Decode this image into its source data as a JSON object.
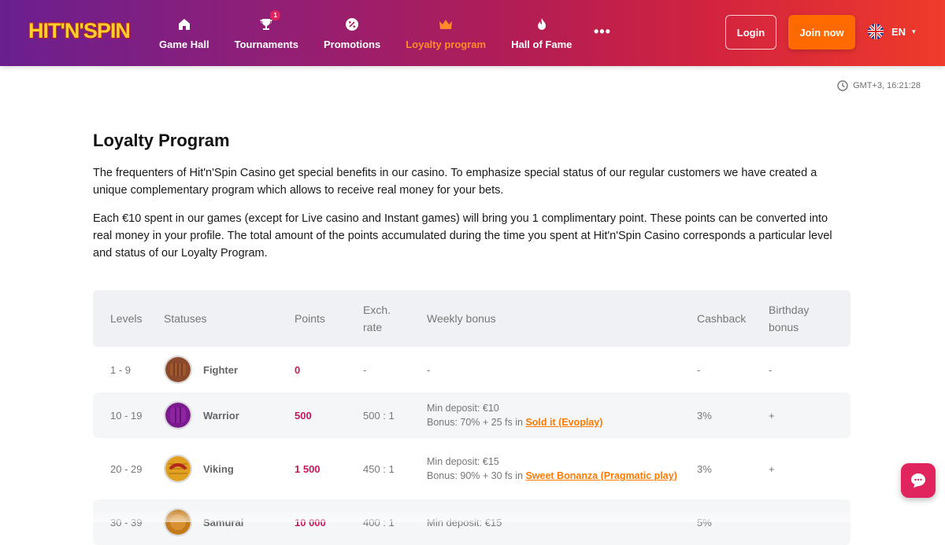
{
  "brand": {
    "logo_text": "HIT'N'SPIN"
  },
  "nav": [
    {
      "label": "Game Hall",
      "icon": "home-icon"
    },
    {
      "label": "Tournaments",
      "icon": "trophy-icon",
      "badge": "1"
    },
    {
      "label": "Promotions",
      "icon": "percent-badge-icon"
    },
    {
      "label": "Loyalty program",
      "icon": "crown-icon",
      "active": true
    },
    {
      "label": "Hall of Fame",
      "icon": "flame-icon"
    }
  ],
  "header": {
    "more": "•••",
    "login": "Login",
    "join": "Join now",
    "lang": "EN"
  },
  "clock": "GMT+3, 16:21:28",
  "page": {
    "title": "Loyalty Program",
    "p1": "The frequenters of Hit'n'Spin Casino get special benefits in our casino. To emphasize special status of our regular customers we have created a unique complementary program which allows to receive real money for your bets.",
    "p2": "Each €10 spent in our games (except for Live casino and Instant games) will bring you 1 complimentary point. These points can be converted into real money in your profile. The total amount of the points accumulated during the time you spent at Hit'n'Spin Casino corresponds a particular level and status of our Loyalty Program."
  },
  "table": {
    "headers": {
      "levels": "Levels",
      "statuses": "Statuses",
      "points": "Points",
      "exch1": "Exch.",
      "exch2": "rate",
      "weekly": "Weekly bonus",
      "cashback": "Cashback",
      "bday1": "Birthday",
      "bday2": "bonus"
    },
    "rows": [
      {
        "levels": "1 - 9",
        "status": "Fighter",
        "points": "0",
        "exch": "-",
        "weekly_line1": "-",
        "weekly_line2": "",
        "weekly_link": "",
        "cashback": "-",
        "birthday": "-",
        "color": "#8b4a2b"
      },
      {
        "levels": "10 - 19",
        "status": "Warrior",
        "points": "500",
        "exch": "500 : 1",
        "weekly_line1": "Min deposit: €10",
        "weekly_line2": "Bonus: 70% + 25 fs in ",
        "weekly_link": "Sold it (Evoplay)",
        "cashback": "3%",
        "birthday": "+",
        "color": "#7a1a8c"
      },
      {
        "levels": "20 - 29",
        "status": "Viking",
        "points": "1 500",
        "exch": "450 : 1",
        "weekly_line1": "Min deposit: €15",
        "weekly_line2": "Bonus: 90% + 30 fs in ",
        "weekly_link": "Sweet Bonanza (Pragmatic play)",
        "cashback": "3%",
        "birthday": "+",
        "color": "#e0a020"
      },
      {
        "levels": "30 - 39",
        "status": "Samurai",
        "points": "10 000",
        "exch": "400 : 1",
        "weekly_line1": "Min deposit: €15",
        "weekly_line2": "",
        "weekly_link": "",
        "cashback": "5%",
        "birthday": "",
        "color": "#c27a1a"
      }
    ]
  }
}
